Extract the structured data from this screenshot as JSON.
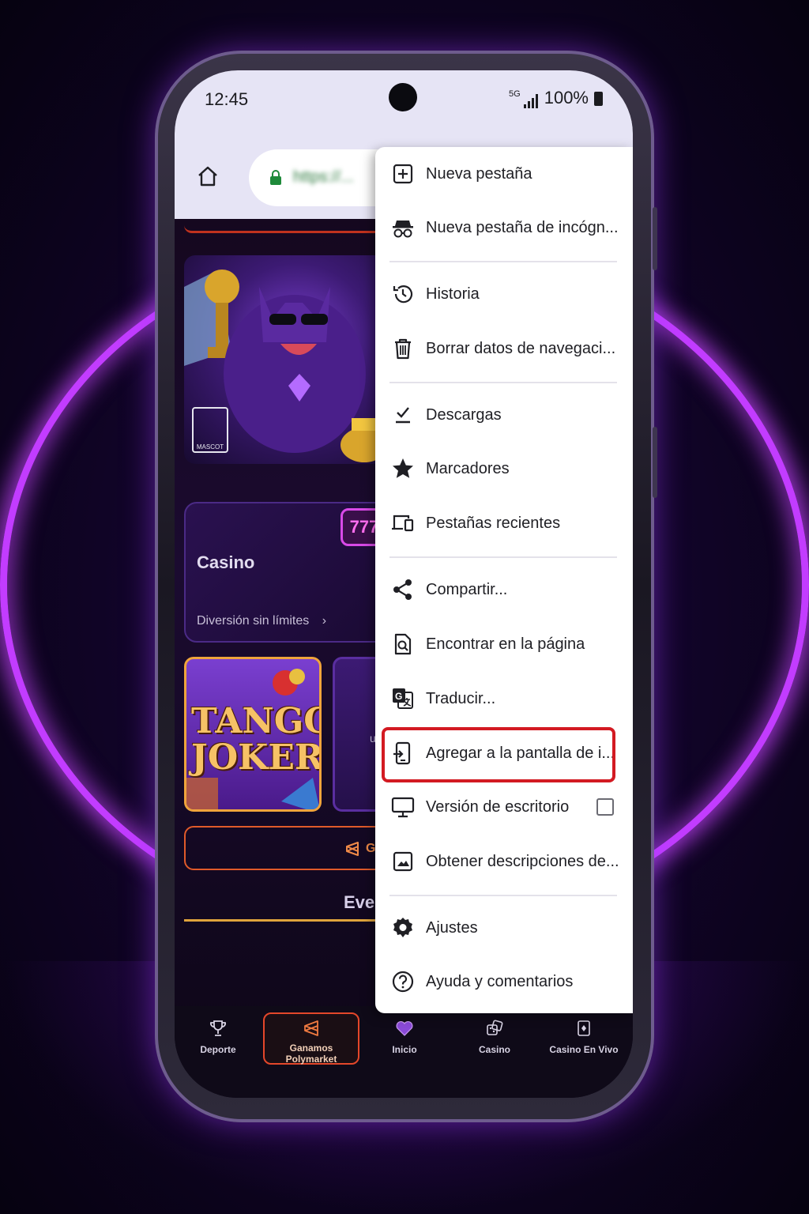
{
  "status_bar": {
    "time": "12:45",
    "network": "5G",
    "battery": "100%"
  },
  "browser": {
    "url": "https://..."
  },
  "page": {
    "casino_card": {
      "title": "Casino",
      "subtitle": "Diversión sin límites",
      "badge": "777"
    },
    "game_tile": {
      "title": "TANGO JOKER"
    },
    "mascot_logo": "MASCOT",
    "cta_fragment": "Ga",
    "second_card_fragment": "u",
    "events_heading_fragment": "Ever"
  },
  "bottom_nav": [
    {
      "label": "Deporte",
      "icon": "trophy-icon"
    },
    {
      "label": "Ganamos Polymarket",
      "icon": "polymarket-icon",
      "active": true
    },
    {
      "label": "Inicio",
      "icon": "heart-logo-icon"
    },
    {
      "label": "Casino",
      "icon": "dice-icon"
    },
    {
      "label": "Casino En Vivo",
      "icon": "live-casino-icon"
    }
  ],
  "menu": {
    "items": [
      {
        "label": "Nueva pestaña",
        "icon": "new-tab-icon"
      },
      {
        "label": "Nueva pestaña de incógn...",
        "icon": "incognito-icon"
      },
      {
        "label": "Historia",
        "icon": "history-icon"
      },
      {
        "label": "Borrar datos de navegaci...",
        "icon": "trash-icon"
      },
      {
        "label": "Descargas",
        "icon": "downloads-icon"
      },
      {
        "label": "Marcadores",
        "icon": "star-icon"
      },
      {
        "label": "Pestañas recientes",
        "icon": "recent-tabs-icon"
      },
      {
        "label": "Compartir...",
        "icon": "share-icon"
      },
      {
        "label": "Encontrar en la página",
        "icon": "find-in-page-icon"
      },
      {
        "label": "Traducir...",
        "icon": "translate-icon"
      },
      {
        "label": "Agregar a la pantalla de i...",
        "icon": "add-to-home-icon",
        "highlighted": true
      },
      {
        "label": "Versión de escritorio",
        "icon": "desktop-icon",
        "checked": false
      },
      {
        "label": "Obtener descripciones de...",
        "icon": "image-description-icon"
      },
      {
        "label": "Ajustes",
        "icon": "settings-icon"
      },
      {
        "label": "Ayuda y comentarios",
        "icon": "help-icon"
      }
    ]
  },
  "colors": {
    "neon": "#c23cff",
    "highlight_border": "#d31a22",
    "menu_background": "#ffffff",
    "toolbar_background": "#e6e4f5"
  }
}
